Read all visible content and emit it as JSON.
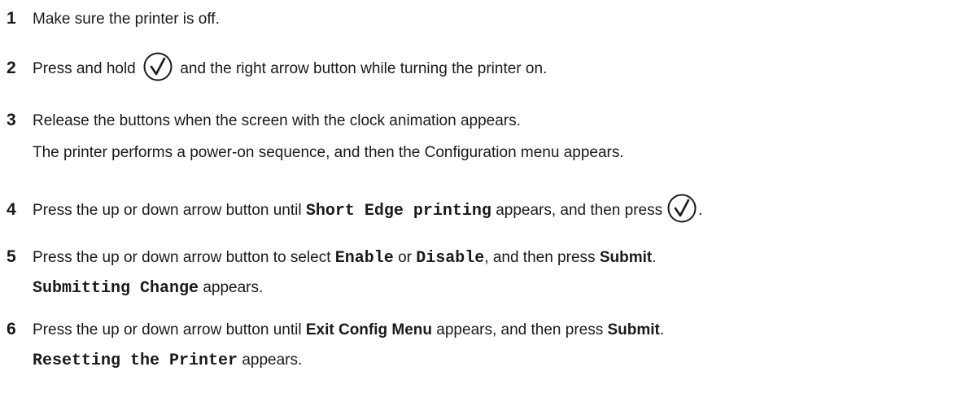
{
  "steps": [
    {
      "number": "1",
      "text": "Make sure the printer is off."
    },
    {
      "number": "2",
      "text_before": "Press and hold",
      "icon": "checkmark-button-icon",
      "text_after": "and the right arrow button while turning the printer on."
    },
    {
      "number": "3",
      "text": "Release the buttons when the screen with the clock animation appears.",
      "note": "The printer performs a power-on sequence, and then the Configuration menu appears."
    },
    {
      "number": "4",
      "text_before": "Press the up or down arrow button until",
      "code": "Short Edge printing",
      "text_middle": "appears, and then press",
      "icon": "checkmark-button-icon",
      "text_after": "."
    },
    {
      "number": "5",
      "text_before": "Press the up or down arrow button to select",
      "code1": "Enable",
      "text_or": "or",
      "code2": "Disable",
      "text_middle": ", and then press",
      "bold_end": "Submit",
      "text_after": ".",
      "note_code": "Submitting Change",
      "note_text": "appears."
    },
    {
      "number": "6",
      "text_before": "Press the up or down arrow button until",
      "bold1": "Exit Config Menu",
      "text_middle": "appears, and then press",
      "bold2": "Submit",
      "text_after": ".",
      "note_code": "Resetting the Printer",
      "note_text": "appears."
    }
  ]
}
